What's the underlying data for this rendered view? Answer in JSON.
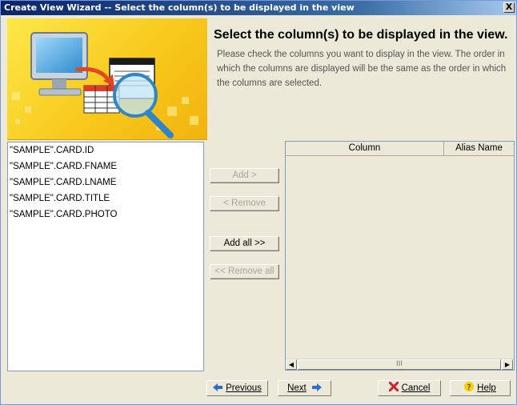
{
  "window": {
    "title": "Create View Wizard -- Select the column(s) to be displayed in the view",
    "close_glyph": "X"
  },
  "page": {
    "heading": "Select the column(s) to be displayed in the view.",
    "description": "Please check the columns you want to display in the view. The order in which the columns are displayed will be the same as the order in which the columns are selected."
  },
  "available_columns": [
    "\"SAMPLE\".CARD.ID",
    "\"SAMPLE\".CARD.FNAME",
    "\"SAMPLE\".CARD.LNAME",
    "\"SAMPLE\".CARD.TITLE",
    "\"SAMPLE\".CARD.PHOTO"
  ],
  "transfer_buttons": {
    "add": {
      "label": "Add >",
      "enabled": false
    },
    "remove": {
      "label": "< Remove",
      "enabled": false
    },
    "add_all": {
      "label": "Add all >>",
      "enabled": true
    },
    "remove_all": {
      "label": "<< Remove all",
      "enabled": false
    }
  },
  "selected_table": {
    "headers": [
      "Column",
      "Alias Name"
    ],
    "rows": [],
    "scroll_thumb_glyph": "III"
  },
  "footer": {
    "previous": "Previous",
    "next": "Next",
    "cancel": "Cancel",
    "help": "Help"
  },
  "colors": {
    "title_bar": "#0a246a",
    "banner_yellow": "#f8c91c",
    "nav_arrow": "#2f6cc7",
    "cancel_x": "#d0242a",
    "help_icon": "#e0b800"
  },
  "icons": {
    "banner": "wizard-monitor-magnifier-illustration",
    "previous": "left-arrow-icon",
    "next": "right-arrow-icon",
    "cancel": "red-x-icon",
    "help": "question-mark-icon"
  }
}
